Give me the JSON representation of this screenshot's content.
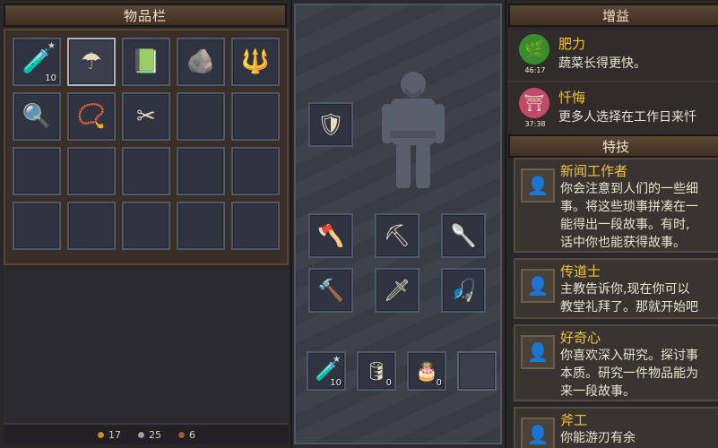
{
  "inventory": {
    "title": "物品栏",
    "slots": [
      {
        "icon": "red-potion-icon",
        "glyph": "🧪",
        "count": "10",
        "star": true
      },
      {
        "icon": "umbrella-icon",
        "glyph": "☂",
        "count": "",
        "active": true
      },
      {
        "icon": "green-book-icon",
        "glyph": "📗",
        "count": ""
      },
      {
        "icon": "black-ore-icon",
        "glyph": "🪨",
        "count": ""
      },
      {
        "icon": "pitchfork-icon",
        "glyph": "🔱",
        "count": ""
      },
      {
        "icon": "hand-mirror-icon",
        "glyph": "🔍",
        "count": ""
      },
      {
        "icon": "red-amulet-icon",
        "glyph": "📿",
        "count": ""
      },
      {
        "icon": "gold-scissors-icon",
        "glyph": "✂",
        "count": ""
      }
    ],
    "total_slots": 20
  },
  "currency": {
    "gold": "17",
    "silver": "25",
    "copper": "6",
    "colors": {
      "gold": "#d18a2a",
      "silver": "#9aa0a8",
      "copper": "#a55a3a"
    }
  },
  "character": {
    "armor_icon": "chest-armor-icon",
    "tools": [
      {
        "icon": "axe-icon",
        "glyph": "🪓"
      },
      {
        "icon": "pickaxe-icon",
        "glyph": "⛏"
      },
      {
        "icon": "shovel-icon",
        "glyph": "🥄"
      },
      {
        "icon": "hammer-icon",
        "glyph": "🔨"
      },
      {
        "icon": "sword-icon",
        "glyph": "🗡"
      },
      {
        "icon": "fishing-rod-icon",
        "glyph": "🎣"
      }
    ],
    "quick": [
      {
        "icon": "red-potion-icon",
        "glyph": "🧪",
        "count": "10",
        "star": true
      },
      {
        "icon": "barrel-icon",
        "glyph": "🛢",
        "count": "0"
      },
      {
        "icon": "cake-icon",
        "glyph": "🎂",
        "count": "0"
      },
      {
        "icon": "",
        "glyph": "",
        "count": ""
      }
    ]
  },
  "buffs": {
    "title": "增益",
    "items": [
      {
        "icon": "leaf-icon",
        "glyph": "🌿",
        "color": "#3a8a2e",
        "time": "46:17",
        "name": "肥力",
        "desc": "蔬菜长得更快。"
      },
      {
        "icon": "repent-icon",
        "glyph": "⛩",
        "color": "#c24a6a",
        "time": "37:38",
        "name": "忏悔",
        "desc": "更多人选择在工作日来忏"
      }
    ]
  },
  "skills": {
    "title": "特技",
    "items": [
      {
        "icon": "journalist-icon",
        "name": "新闻工作者",
        "lines": [
          "你会注意到人们的一些细",
          "事。将这些琐事拼凑在一",
          "能得出一段故事。有时,",
          "话中你也能获得故事。"
        ]
      },
      {
        "icon": "preacher-icon",
        "name": "传道士",
        "lines": [
          "主教告诉你,现在你可以",
          "教堂礼拜了。那就开始吧"
        ]
      },
      {
        "icon": "curious-icon",
        "name": "好奇心",
        "lines": [
          "你喜欢深入研究。探讨事",
          "本质。研究一件物品能为",
          "来一段故事。"
        ]
      },
      {
        "icon": "worker-icon",
        "name": "斧工",
        "lines": [
          "你能游刃有余"
        ]
      }
    ]
  }
}
